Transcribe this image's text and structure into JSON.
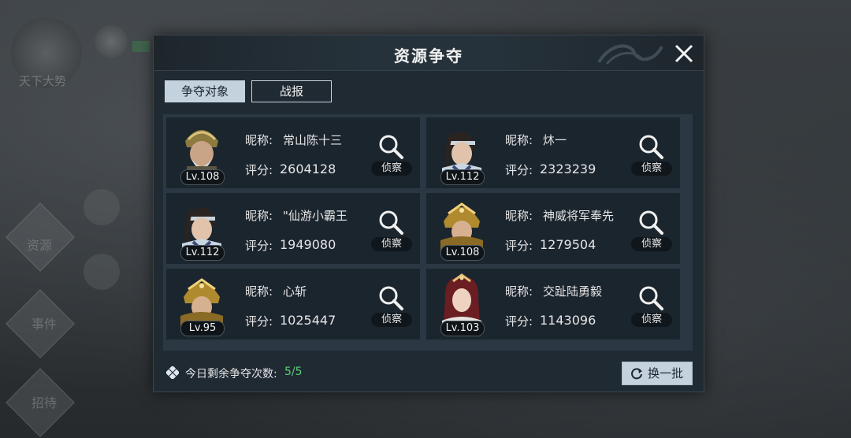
{
  "background": {
    "emblem_label": "天下大势",
    "side_labels": [
      "资源",
      "事件",
      "招待"
    ]
  },
  "dialog": {
    "title": "资源争夺",
    "tabs": [
      {
        "label": "争夺对象",
        "active": true
      },
      {
        "label": "战报",
        "active": false
      }
    ],
    "name_prefix": "昵称:",
    "score_prefix": "评分:",
    "scout_label": "侦察",
    "opponents": [
      {
        "level": "Lv.108",
        "name": "常山陈十三",
        "score": "2604128",
        "portrait": "armored-general-gold-helmet"
      },
      {
        "level": "Lv.112",
        "name": "炑一",
        "score": "2323239",
        "portrait": "young-warrior-headband"
      },
      {
        "level": "Lv.112",
        "name": "\"仙游小霸王",
        "score": "1949080",
        "portrait": "young-warrior-headband"
      },
      {
        "level": "Lv.108",
        "name": "神威将军奉先",
        "score": "1279504",
        "portrait": "golden-crown-warrior"
      },
      {
        "level": "Lv.95",
        "name": "心斩",
        "score": "1025447",
        "portrait": "golden-crown-warrior"
      },
      {
        "level": "Lv.103",
        "name": "交趾陆勇毅",
        "score": "1143096",
        "portrait": "female-red-hair-crown"
      }
    ],
    "footer": {
      "remaining_label": "今日剩余争夺次数:",
      "remaining_count": "5/5",
      "refresh_label": "换一批"
    }
  },
  "colors": {
    "accent_green": "#5fd07a",
    "tab_active_bg": "#c4d2de",
    "panel_bg": "#2b3742",
    "card_bg": "#1b252e"
  }
}
